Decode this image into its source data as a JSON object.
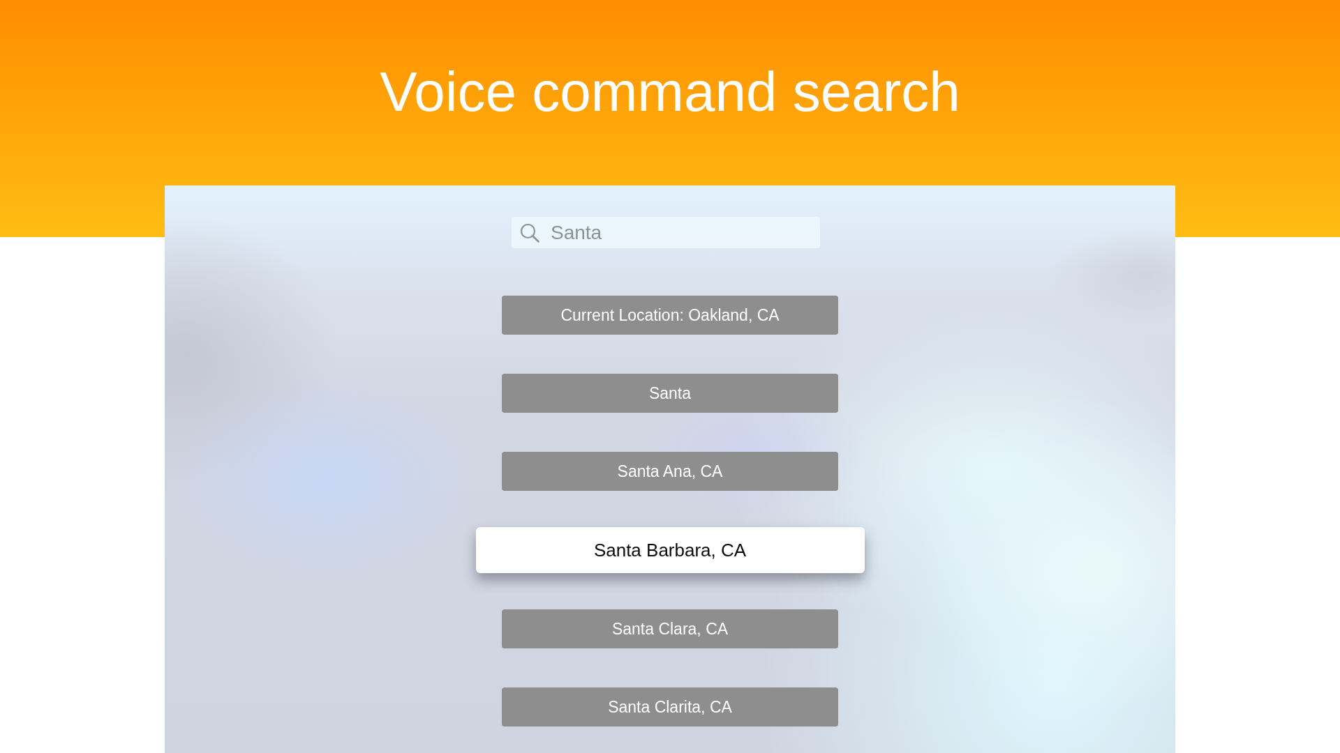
{
  "header": {
    "title": "Voice command search"
  },
  "search": {
    "value": "Santa"
  },
  "results": [
    {
      "label": "Current Location: Oakland, CA",
      "selected": false
    },
    {
      "label": "Santa",
      "selected": false
    },
    {
      "label": "Santa Ana, CA",
      "selected": false
    },
    {
      "label": "Santa Barbara, CA",
      "selected": true
    },
    {
      "label": "Santa Clara, CA",
      "selected": false
    },
    {
      "label": "Santa Clarita, CA",
      "selected": false
    }
  ]
}
